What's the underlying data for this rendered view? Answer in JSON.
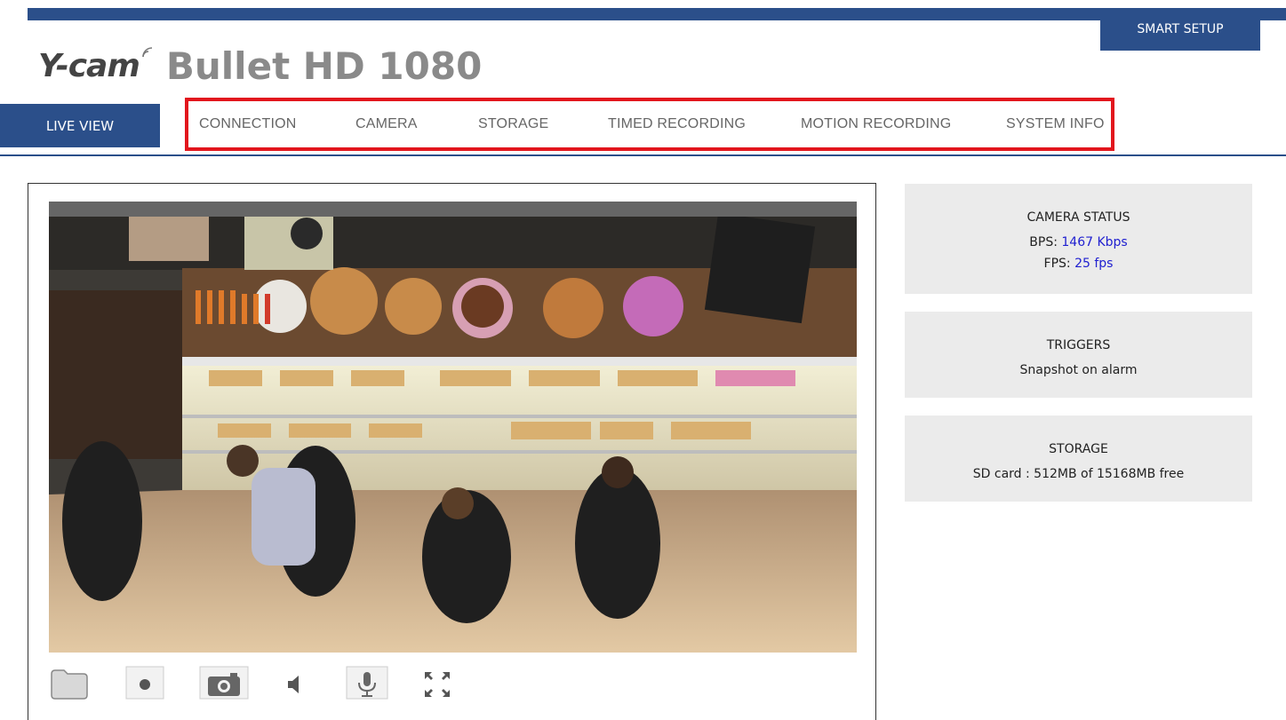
{
  "header": {
    "smart_setup_label": "SMART SETUP",
    "brand_logo": "Y-cam",
    "brand_model": "Bullet HD 1080"
  },
  "nav": {
    "live_view": "LIVE VIEW",
    "items": [
      "CONNECTION",
      "CAMERA",
      "STORAGE",
      "TIMED RECORDING",
      "MOTION RECORDING",
      "SYSTEM INFO"
    ]
  },
  "colors": {
    "brand_blue": "#2b4f8a",
    "highlight_red": "#e2161d",
    "value_blue": "#2020d0",
    "card_gray": "#ebebeb"
  },
  "controls": {
    "icons": [
      "folder-icon",
      "record-icon",
      "snapshot-icon",
      "speaker-icon",
      "microphone-icon",
      "fullscreen-icon"
    ]
  },
  "status": {
    "camera": {
      "title": "CAMERA STATUS",
      "bps_label": "BPS:",
      "bps_value": "1467 Kbps",
      "fps_label": "FPS:",
      "fps_value": "25 fps"
    },
    "triggers": {
      "title": "TRIGGERS",
      "text": "Snapshot on alarm"
    },
    "storage": {
      "title": "STORAGE",
      "text": "SD card : 512MB of 15168MB free"
    }
  }
}
